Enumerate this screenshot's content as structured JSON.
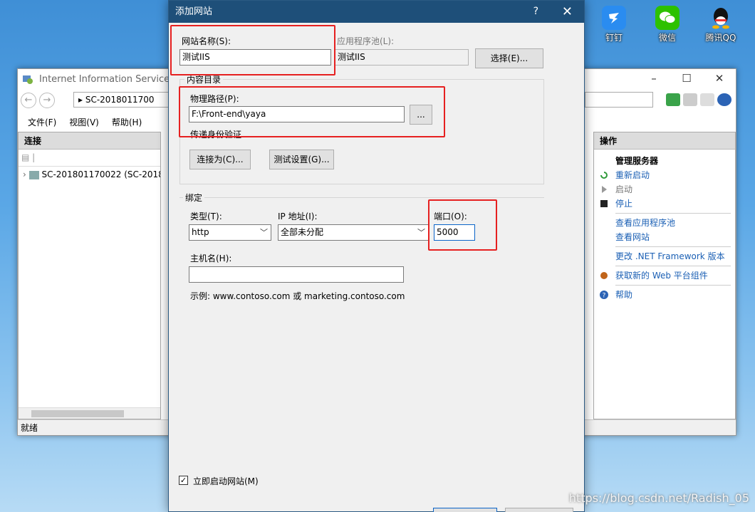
{
  "desktop": {
    "icons": [
      {
        "label": "钉钉",
        "icon": "dingtalk-icon",
        "color": "#2a8cf0"
      },
      {
        "label": "微信",
        "icon": "wechat-icon",
        "color": "#2dc100"
      },
      {
        "label": "腾讯QQ",
        "icon": "qq-icon",
        "color": "#111111"
      }
    ],
    "watermark": "https://blog.csdn.net/Radish_05"
  },
  "iis": {
    "title": "Internet Information Services (II",
    "address": "SC-2018011700",
    "menu": [
      "文件(F)",
      "视图(V)",
      "帮助(H)"
    ],
    "connections_header": "连接",
    "tree_item": "SC-201801170022 (SC-2018",
    "actions_header": "操作",
    "actions": [
      {
        "label": "管理服务器",
        "style": "bold",
        "icon": ""
      },
      {
        "label": "重新启动",
        "style": "link",
        "icon": "restart-icon"
      },
      {
        "label": "启动",
        "style": "dim",
        "icon": "start-icon"
      },
      {
        "label": "停止",
        "style": "link",
        "icon": "stop-icon"
      },
      {
        "label": "查看应用程序池",
        "style": "link",
        "icon": ""
      },
      {
        "label": "查看网站",
        "style": "link",
        "icon": ""
      },
      {
        "label": "更改 .NET Framework 版本",
        "style": "link",
        "icon": ""
      },
      {
        "label": "获取新的 Web 平台组件",
        "style": "link",
        "icon": "web-platform-icon"
      },
      {
        "label": "帮助",
        "style": "link",
        "icon": "help-icon"
      }
    ],
    "status": "就绪"
  },
  "dialog": {
    "title": "添加网站",
    "help_glyph": "?",
    "close_glyph": "✕",
    "site_name_label": "网站名称(S):",
    "site_name_value": "测试IIS",
    "app_pool_label": "应用程序池(L):",
    "app_pool_value": "测试IIS",
    "select_button": "选择(E)...",
    "content_dir_label": "内容目录",
    "physical_path_label": "物理路径(P):",
    "physical_path_value": "F:\\Front-end\\yaya",
    "browse_button": "...",
    "passthrough_label": "传递身份验证",
    "connect_as_button": "连接为(C)...",
    "test_settings_button": "测试设置(G)...",
    "binding_label": "绑定",
    "type_label": "类型(T):",
    "type_value": "http",
    "ip_label": "IP 地址(I):",
    "ip_value": "全部未分配",
    "port_label": "端口(O):",
    "port_value": "5000",
    "hostname_label": "主机名(H):",
    "hostname_value": "",
    "example_text": "示例: www.contoso.com 或 marketing.contoso.com",
    "start_now_label": "立即启动网站(M)",
    "start_now_checked": "✓"
  },
  "colors": {
    "dialog_title_bar": "#1e4f79",
    "highlight_box": "#e62020",
    "link": "#1a5fb4"
  }
}
